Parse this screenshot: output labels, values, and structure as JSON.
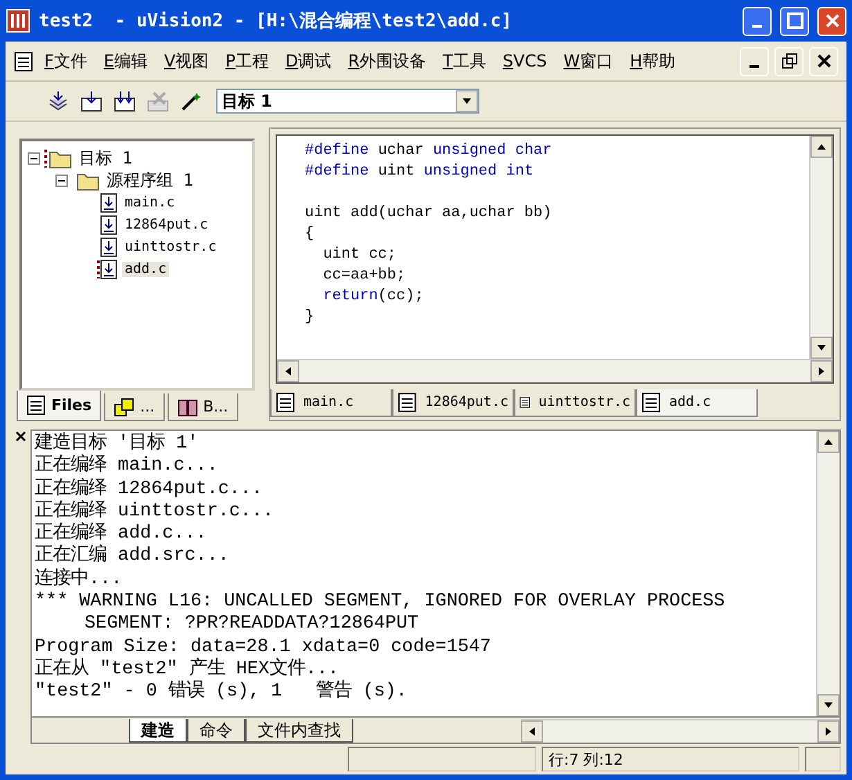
{
  "window": {
    "title": "test2  - uVision2 - [H:\\混合编程\\test2\\add.c]"
  },
  "menu": [
    {
      "key": "F",
      "label": "文件"
    },
    {
      "key": "E",
      "label": "编辑"
    },
    {
      "key": "V",
      "label": "视图"
    },
    {
      "key": "P",
      "label": "工程"
    },
    {
      "key": "D",
      "label": "调试"
    },
    {
      "key": "R",
      "label": "外围设备"
    },
    {
      "key": "T",
      "label": "工具"
    },
    {
      "key": "S",
      "label": "VCS"
    },
    {
      "key": "W",
      "label": "窗口"
    },
    {
      "key": "H",
      "label": "帮助"
    }
  ],
  "toolbar": {
    "target": "目标 1"
  },
  "project_tree": [
    {
      "label": "目标 1",
      "kind": "target",
      "expanded": true,
      "children": [
        {
          "label": "源程序组 1",
          "kind": "group",
          "expanded": true,
          "children": [
            {
              "label": "main.c",
              "kind": "file",
              "selected": false
            },
            {
              "label": "12864put.c",
              "kind": "file",
              "selected": false
            },
            {
              "label": "uinttostr.c",
              "kind": "file",
              "selected": false
            },
            {
              "label": "add.c",
              "kind": "file",
              "selected": true
            }
          ]
        }
      ]
    }
  ],
  "project_tabs": [
    {
      "label": "Files",
      "kind": "files",
      "selected": true
    },
    {
      "label": "...",
      "kind": "regs",
      "selected": false
    },
    {
      "label": "B...",
      "kind": "books",
      "selected": false
    }
  ],
  "editor": {
    "lines": [
      {
        "kind": "code",
        "segments": [
          {
            "text": "#define",
            "kind": "keyword"
          },
          {
            "text": " uchar ",
            "kind": "plain"
          },
          {
            "text": "unsigned char",
            "kind": "keyword"
          }
        ]
      },
      {
        "kind": "code",
        "segments": [
          {
            "text": "#define",
            "kind": "keyword"
          },
          {
            "text": " uint ",
            "kind": "plain"
          },
          {
            "text": "unsigned int",
            "kind": "keyword"
          }
        ]
      },
      {
        "kind": "blank"
      },
      {
        "kind": "code",
        "segments": [
          {
            "text": "uint add(uchar aa,uchar bb)",
            "kind": "plain"
          }
        ]
      },
      {
        "kind": "code",
        "segments": [
          {
            "text": "{",
            "kind": "plain"
          }
        ]
      },
      {
        "kind": "indented",
        "segments": [
          {
            "text": "uint cc;",
            "kind": "plain"
          }
        ]
      },
      {
        "kind": "indented",
        "segments": [
          {
            "text": "cc=aa+bb;",
            "kind": "plain"
          }
        ]
      },
      {
        "kind": "indented",
        "segments": [
          {
            "text": "return",
            "kind": "keyword"
          },
          {
            "text": "(cc);",
            "kind": "plain"
          }
        ]
      },
      {
        "kind": "code",
        "segments": [
          {
            "text": "}",
            "kind": "plain"
          }
        ]
      }
    ]
  },
  "editor_tabs": [
    {
      "label": "main.c",
      "selected": false
    },
    {
      "label": "12864put.c",
      "selected": false
    },
    {
      "label": "uinttostr.c",
      "selected": false
    },
    {
      "label": "add.c",
      "selected": true
    }
  ],
  "output": {
    "lines": [
      {
        "text": "建造目标 '目标 1'",
        "kind": "normal"
      },
      {
        "text": "正在编绎 main.c...",
        "kind": "normal"
      },
      {
        "text": "正在编绎 12864put.c...",
        "kind": "normal"
      },
      {
        "text": "正在编绎 uinttostr.c...",
        "kind": "normal"
      },
      {
        "text": "正在编绎 add.c...",
        "kind": "normal"
      },
      {
        "text": "正在汇编 add.src...",
        "kind": "normal"
      },
      {
        "text": "连接中...",
        "kind": "normal"
      },
      {
        "text": "*** WARNING L16: UNCALLED SEGMENT, IGNORED FOR OVERLAY PROCESS",
        "kind": "normal"
      },
      {
        "text": "SEGMENT: ?PR?READDATA?12864PUT",
        "kind": "continuation"
      },
      {
        "text": "Program Size: data=28.1 xdata=0 code=1547",
        "kind": "normal"
      },
      {
        "text": "正在从 \"test2\" 产生 HEX文件...",
        "kind": "normal"
      },
      {
        "text": "\"test2\" - 0 错误 (s), 1   警告 (s).",
        "kind": "normal"
      }
    ]
  },
  "output_tabs": [
    {
      "label": "建造",
      "selected": true
    },
    {
      "label": "命令",
      "selected": false
    },
    {
      "label": "文件内查找",
      "selected": false
    }
  ],
  "status_bar": {
    "position": "行:7 列:12"
  }
}
